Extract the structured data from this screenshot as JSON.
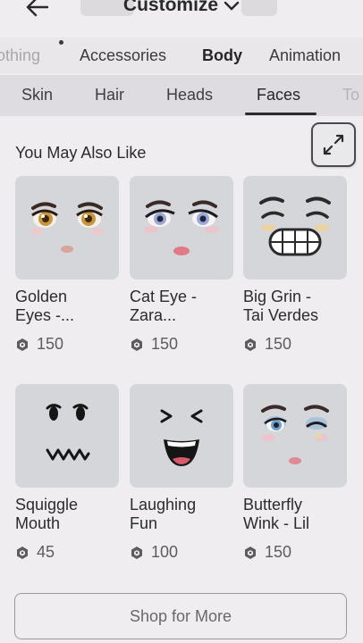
{
  "header": {
    "title": "Customize"
  },
  "category_tabs": [
    {
      "label": "othing"
    },
    {
      "label": "Accessories"
    },
    {
      "label": "Body"
    },
    {
      "label": "Animation"
    }
  ],
  "sub_tabs": [
    {
      "label": "Skin"
    },
    {
      "label": "Hair"
    },
    {
      "label": "Heads"
    },
    {
      "label": "Faces"
    },
    {
      "label": "To"
    }
  ],
  "section": {
    "title": "You May Also Like"
  },
  "items": [
    {
      "name_line1": "Golden",
      "name_line2": "Eyes -...",
      "price": "150"
    },
    {
      "name_line1": "Cat Eye -",
      "name_line2": "Zara...",
      "price": "150"
    },
    {
      "name_line1": "Big Grin -",
      "name_line2": "Tai Verdes",
      "price": "150"
    },
    {
      "name_line1": "Squiggle",
      "name_line2": "Mouth",
      "price": "45"
    },
    {
      "name_line1": "Laughing",
      "name_line2": "Fun",
      "price": "100"
    },
    {
      "name_line1": "Butterfly",
      "name_line2": "Wink - Lil",
      "price": "150"
    }
  ],
  "shop_button": {
    "label": "Shop for More"
  }
}
